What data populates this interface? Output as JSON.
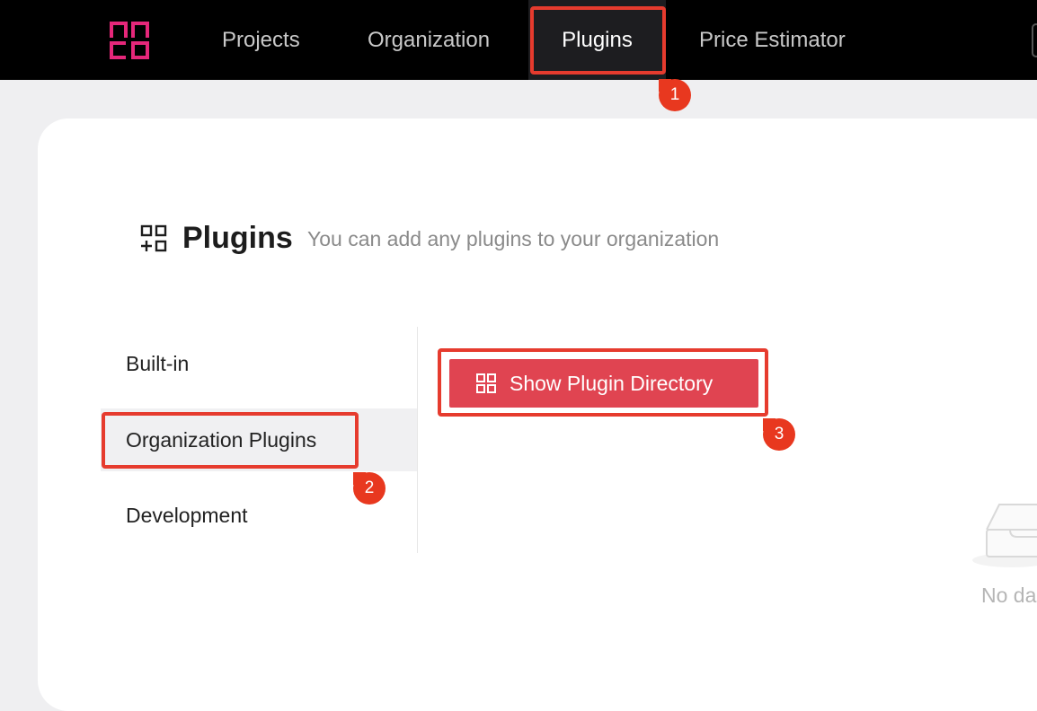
{
  "nav": {
    "items": [
      {
        "label": "Projects"
      },
      {
        "label": "Organization"
      },
      {
        "label": "Plugins",
        "active": true
      },
      {
        "label": "Price Estimator"
      }
    ]
  },
  "header": {
    "title": "Plugins",
    "subtitle": "You can add any plugins to your organization"
  },
  "sidebar": {
    "items": [
      {
        "label": "Built-in"
      },
      {
        "label": "Organization Plugins",
        "active": true
      },
      {
        "label": "Development"
      }
    ]
  },
  "main": {
    "show_directory_button": "Show Plugin Directory",
    "empty_text": "No da"
  },
  "annotations": {
    "badges": [
      "1",
      "2",
      "3"
    ],
    "color": "#e8381f"
  },
  "colors": {
    "brand": "#e6277a",
    "button": "#e04451",
    "topbar": "#000000"
  },
  "icons": {
    "logo": "brand-logo",
    "title": "add-apps-icon",
    "button": "grid-icon",
    "empty": "empty-inbox-icon"
  }
}
